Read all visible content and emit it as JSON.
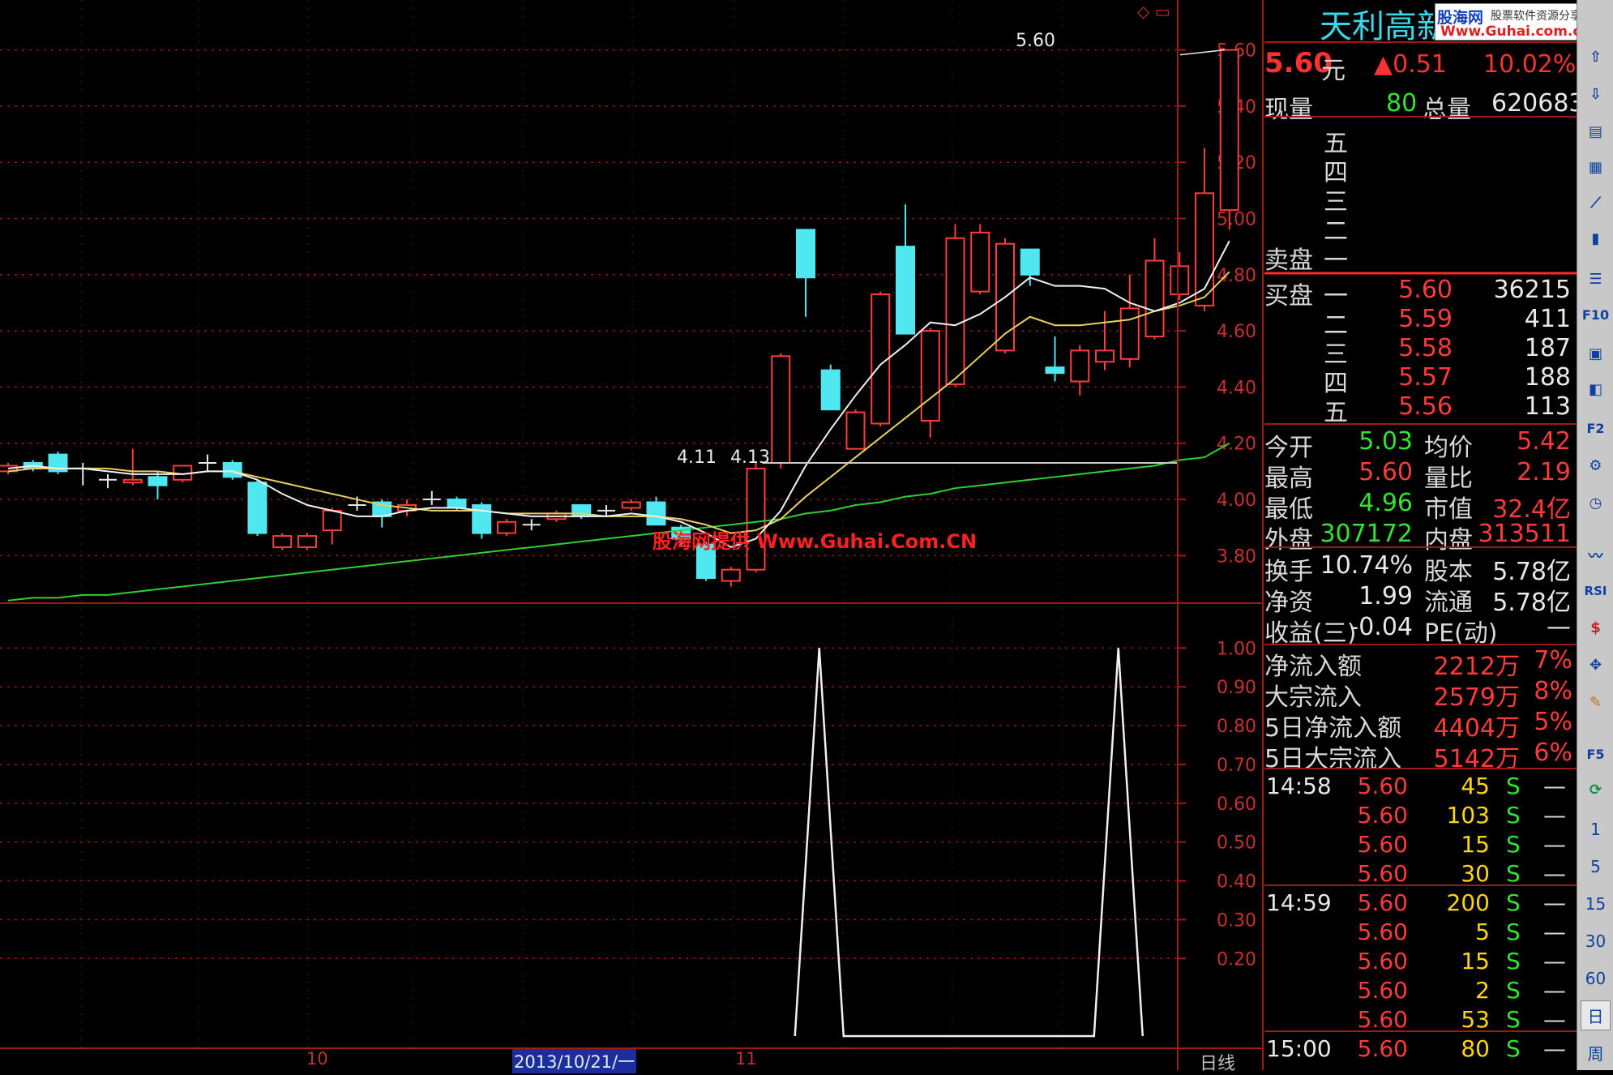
{
  "stock": {
    "name": "天利高新",
    "price": "5.60",
    "price_unit": "元",
    "change": "▲0.51",
    "change_pct": "10.02%"
  },
  "watermark_top": {
    "brand": "股海网",
    "slogan": "股票软件资源分享",
    "url": "Www.Guhai.com.cn"
  },
  "watermark_center": "股海网提供 Www.Guhai.Com.CN",
  "volume_row": {
    "cur_label": "现量",
    "cur_value": "80",
    "total_label": "总量",
    "total_value": "620683"
  },
  "sell_panel": {
    "label": "卖盘",
    "levels": [
      "五",
      "四",
      "三",
      "二",
      "一"
    ]
  },
  "buy_panel": {
    "label": "买盘",
    "levels": [
      {
        "level": "一",
        "price": "5.60",
        "volume": "36215"
      },
      {
        "level": "二",
        "price": "5.59",
        "volume": "411"
      },
      {
        "level": "三",
        "price": "5.58",
        "volume": "187"
      },
      {
        "level": "四",
        "price": "5.57",
        "volume": "188"
      },
      {
        "level": "五",
        "price": "5.56",
        "volume": "113"
      }
    ]
  },
  "stats": [
    {
      "l1": "今开",
      "v1": "5.03",
      "l2": "均价",
      "v2": "5.42"
    },
    {
      "l1": "最高",
      "v1": "5.60",
      "l2": "量比",
      "v2": "2.19"
    },
    {
      "l1": "最低",
      "v1": "4.96",
      "l2": "市值",
      "v2": "32.4亿"
    },
    {
      "l1": "外盘",
      "v1": "307172",
      "l2": "内盘",
      "v2": "313511"
    }
  ],
  "fundamentals": [
    {
      "l1": "换手",
      "v1": "10.74%",
      "l2": "股本",
      "v2": "5.78亿"
    },
    {
      "l1": "净资",
      "v1": "1.99",
      "l2": "流通",
      "v2": "5.78亿"
    },
    {
      "l1": "收益(三)",
      "v1": "-0.04",
      "l2": "PE(动)",
      "v2": "—"
    }
  ],
  "flows": [
    {
      "label": "净流入额",
      "amount": "2212万",
      "pct": "7%"
    },
    {
      "label": "大宗流入",
      "amount": "2579万",
      "pct": "8%"
    },
    {
      "label": "5日净流入额",
      "amount": "4404万",
      "pct": "5%"
    },
    {
      "label": "5日大宗流入",
      "amount": "5142万",
      "pct": "6%"
    }
  ],
  "ticks": [
    {
      "time": "14:58",
      "price": "5.60",
      "vol": "45",
      "side": "S",
      "dash": "—"
    },
    {
      "time": "",
      "price": "5.60",
      "vol": "103",
      "side": "S",
      "dash": "—"
    },
    {
      "time": "",
      "price": "5.60",
      "vol": "15",
      "side": "S",
      "dash": "—"
    },
    {
      "time": "",
      "price": "5.60",
      "vol": "30",
      "side": "S",
      "dash": "—"
    },
    {
      "time": "14:59",
      "price": "5.60",
      "vol": "200",
      "side": "S",
      "dash": "—"
    },
    {
      "time": "",
      "price": "5.60",
      "vol": "5",
      "side": "S",
      "dash": "—"
    },
    {
      "time": "",
      "price": "5.60",
      "vol": "15",
      "side": "S",
      "dash": "—"
    },
    {
      "time": "",
      "price": "5.60",
      "vol": "2",
      "side": "S",
      "dash": "—"
    },
    {
      "time": "",
      "price": "5.60",
      "vol": "53",
      "side": "S",
      "dash": "—"
    },
    {
      "time": "15:00",
      "price": "5.60",
      "vol": "80",
      "side": "S",
      "dash": "—"
    }
  ],
  "chart_data": [
    {
      "type": "candlestick",
      "title": "",
      "y_ticks": [
        "5.60",
        "5.40",
        "5.20",
        "5.00",
        "4.80",
        "4.60",
        "4.40",
        "4.20",
        "4.00",
        "3.80"
      ],
      "ylim": [
        3.7,
        5.72
      ],
      "grid": true,
      "annotations": {
        "high_label": "5.60",
        "low_labels": [
          "4.11",
          "4.13"
        ]
      },
      "candles": [
        {
          "o": 4.1,
          "c": 4.12,
          "h": 4.13,
          "l": 4.09
        },
        {
          "o": 4.13,
          "c": 4.11,
          "h": 4.14,
          "l": 4.1
        },
        {
          "o": 4.16,
          "c": 4.1,
          "h": 4.17,
          "l": 4.09
        },
        {
          "o": 4.11,
          "c": 4.11,
          "h": 4.13,
          "l": 4.05
        },
        {
          "o": 4.07,
          "c": 4.07,
          "h": 4.09,
          "l": 4.04
        },
        {
          "o": 4.06,
          "c": 4.07,
          "h": 4.18,
          "l": 4.05
        },
        {
          "o": 4.08,
          "c": 4.05,
          "h": 4.1,
          "l": 4.0
        },
        {
          "o": 4.07,
          "c": 4.12,
          "h": 4.12,
          "l": 4.06
        },
        {
          "o": 4.13,
          "c": 4.13,
          "h": 4.16,
          "l": 4.1
        },
        {
          "o": 4.13,
          "c": 4.08,
          "h": 4.14,
          "l": 4.07
        },
        {
          "o": 4.06,
          "c": 3.88,
          "h": 4.07,
          "l": 3.87
        },
        {
          "o": 3.83,
          "c": 3.87,
          "h": 3.88,
          "l": 3.82
        },
        {
          "o": 3.83,
          "c": 3.87,
          "h": 3.88,
          "l": 3.82
        },
        {
          "o": 3.89,
          "c": 3.96,
          "h": 3.97,
          "l": 3.84
        },
        {
          "o": 3.98,
          "c": 3.98,
          "h": 4.01,
          "l": 3.96
        },
        {
          "o": 3.99,
          "c": 3.94,
          "h": 4.0,
          "l": 3.9
        },
        {
          "o": 3.96,
          "c": 3.98,
          "h": 4.0,
          "l": 3.94
        },
        {
          "o": 4.0,
          "c": 4.0,
          "h": 4.03,
          "l": 3.98
        },
        {
          "o": 4.0,
          "c": 3.97,
          "h": 4.01,
          "l": 3.96
        },
        {
          "o": 3.98,
          "c": 3.88,
          "h": 3.99,
          "l": 3.86
        },
        {
          "o": 3.88,
          "c": 3.92,
          "h": 3.93,
          "l": 3.87
        },
        {
          "o": 3.91,
          "c": 3.91,
          "h": 3.93,
          "l": 3.89
        },
        {
          "o": 3.93,
          "c": 3.95,
          "h": 3.96,
          "l": 3.92
        },
        {
          "o": 3.98,
          "c": 3.94,
          "h": 3.98,
          "l": 3.93
        },
        {
          "o": 3.96,
          "c": 3.96,
          "h": 3.98,
          "l": 3.94
        },
        {
          "o": 3.97,
          "c": 3.99,
          "h": 4.0,
          "l": 3.96
        },
        {
          "o": 3.99,
          "c": 3.91,
          "h": 4.01,
          "l": 3.91
        },
        {
          "o": 3.9,
          "c": 3.86,
          "h": 3.91,
          "l": 3.83
        },
        {
          "o": 3.84,
          "c": 3.72,
          "h": 3.85,
          "l": 3.71
        },
        {
          "o": 3.71,
          "c": 3.75,
          "h": 3.76,
          "l": 3.69
        },
        {
          "o": 3.75,
          "c": 4.11,
          "h": 4.13,
          "l": 3.74
        },
        {
          "o": 4.13,
          "c": 4.51,
          "h": 4.52,
          "l": 4.11
        },
        {
          "o": 4.96,
          "c": 4.79,
          "h": 4.96,
          "l": 4.65
        },
        {
          "o": 4.46,
          "c": 4.32,
          "h": 4.48,
          "l": 4.32
        },
        {
          "o": 4.18,
          "c": 4.31,
          "h": 4.32,
          "l": 4.18
        },
        {
          "o": 4.27,
          "c": 4.73,
          "h": 4.74,
          "l": 4.26
        },
        {
          "o": 4.9,
          "c": 4.59,
          "h": 5.05,
          "l": 4.59
        },
        {
          "o": 4.28,
          "c": 4.6,
          "h": 4.61,
          "l": 4.22
        },
        {
          "o": 4.41,
          "c": 4.93,
          "h": 4.98,
          "l": 4.4
        },
        {
          "o": 4.74,
          "c": 4.95,
          "h": 4.98,
          "l": 4.73
        },
        {
          "o": 4.53,
          "c": 4.91,
          "h": 4.93,
          "l": 4.52
        },
        {
          "o": 4.89,
          "c": 4.8,
          "h": 4.86,
          "l": 4.76
        },
        {
          "o": 4.47,
          "c": 4.45,
          "h": 4.58,
          "l": 4.42
        },
        {
          "o": 4.42,
          "c": 4.53,
          "h": 4.55,
          "l": 4.37
        },
        {
          "o": 4.49,
          "c": 4.53,
          "h": 4.67,
          "l": 4.46
        },
        {
          "o": 4.5,
          "c": 4.68,
          "h": 4.8,
          "l": 4.47
        },
        {
          "o": 4.58,
          "c": 4.85,
          "h": 4.93,
          "l": 4.57
        },
        {
          "o": 4.73,
          "c": 4.83,
          "h": 4.88,
          "l": 4.71
        },
        {
          "o": 4.69,
          "c": 5.09,
          "h": 5.25,
          "l": 4.67
        },
        {
          "o": 5.03,
          "c": 5.6,
          "h": 5.6,
          "l": 4.96
        }
      ],
      "ma_white": [
        4.11,
        4.12,
        4.11,
        4.11,
        4.1,
        4.09,
        4.09,
        4.09,
        4.1,
        4.1,
        4.07,
        4.02,
        3.98,
        3.96,
        3.94,
        3.94,
        3.96,
        3.97,
        3.97,
        3.96,
        3.95,
        3.94,
        3.94,
        3.94,
        3.94,
        3.95,
        3.94,
        3.92,
        3.88,
        3.83,
        3.86,
        3.96,
        4.12,
        4.25,
        4.37,
        4.48,
        4.55,
        4.63,
        4.62,
        4.66,
        4.72,
        4.79,
        4.76,
        4.76,
        4.75,
        4.7,
        4.67,
        4.7,
        4.75,
        4.92
      ],
      "ma_yellow": [
        4.1,
        4.11,
        4.11,
        4.11,
        4.11,
        4.1,
        4.1,
        4.09,
        4.1,
        4.1,
        4.08,
        4.06,
        4.04,
        4.02,
        4.0,
        3.98,
        3.97,
        3.96,
        3.96,
        3.96,
        3.95,
        3.95,
        3.95,
        3.95,
        3.94,
        3.94,
        3.94,
        3.93,
        3.91,
        3.88,
        3.89,
        3.93,
        4.01,
        4.08,
        4.15,
        4.22,
        4.29,
        4.36,
        4.43,
        4.51,
        4.59,
        4.65,
        4.62,
        4.62,
        4.63,
        4.64,
        4.67,
        4.69,
        4.72,
        4.81
      ],
      "ma_green": [
        3.64,
        3.65,
        3.65,
        3.66,
        3.66,
        3.67,
        3.68,
        3.69,
        3.7,
        3.71,
        3.72,
        3.73,
        3.74,
        3.75,
        3.76,
        3.77,
        3.78,
        3.79,
        3.8,
        3.81,
        3.82,
        3.83,
        3.84,
        3.85,
        3.86,
        3.87,
        3.88,
        3.89,
        3.9,
        3.91,
        3.92,
        3.93,
        3.95,
        3.96,
        3.98,
        3.99,
        4.01,
        4.02,
        4.04,
        4.05,
        4.06,
        4.07,
        4.08,
        4.09,
        4.1,
        4.11,
        4.12,
        4.14,
        4.15,
        4.2
      ]
    },
    {
      "type": "line",
      "title": "",
      "y_ticks": [
        "1.00",
        "0.90",
        "0.80",
        "0.70",
        "0.60",
        "0.50",
        "0.40",
        "0.30",
        "0.20"
      ],
      "ylim": [
        0.0,
        1.03
      ],
      "values": [
        0,
        0,
        0,
        0,
        0,
        0,
        0,
        0,
        0,
        0,
        0,
        0,
        0,
        0,
        0,
        0,
        0,
        0,
        0,
        0,
        0,
        0,
        0,
        0,
        0,
        0,
        0,
        0,
        0,
        0,
        0,
        0,
        0,
        0,
        0,
        0,
        0,
        0,
        0,
        0,
        0,
        0,
        0,
        0,
        0,
        0,
        0,
        0,
        0,
        0
      ],
      "peaks": [
        {
          "index": 33,
          "value": 1.0
        },
        {
          "index": 45,
          "value": 1.0
        }
      ]
    }
  ],
  "x_axis": {
    "labels": [
      "10",
      "2013/10/21/一",
      "11"
    ],
    "period": "日线"
  },
  "toolbar": {
    "numbers": [
      "1",
      "5",
      "15",
      "30",
      "60"
    ],
    "day": "日",
    "week": "周",
    "rsi": "RSI",
    "f5": "F5",
    "f10": "F10",
    "f2": "F2"
  }
}
